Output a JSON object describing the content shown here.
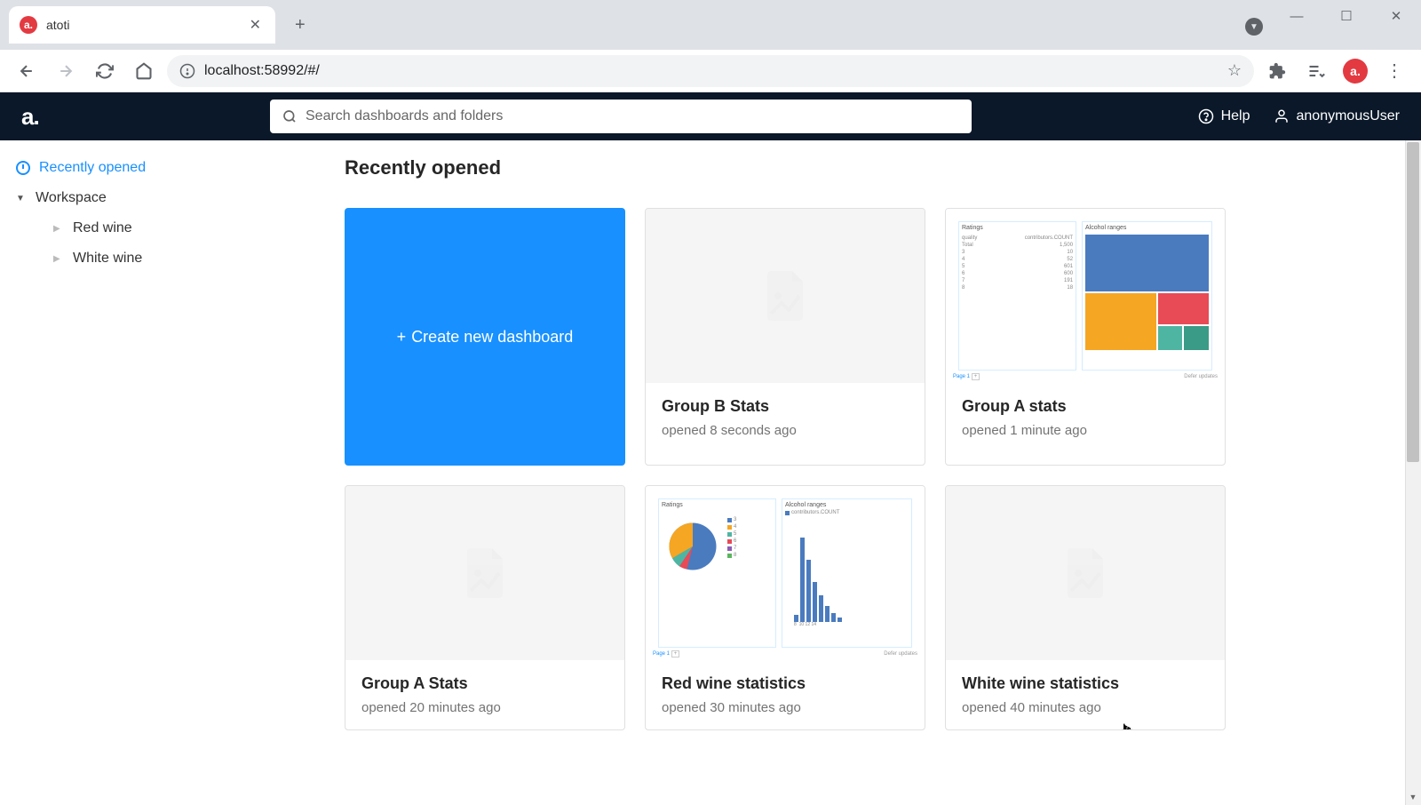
{
  "browser": {
    "tab_title": "atoti",
    "url": "localhost:58992/#/"
  },
  "header": {
    "logo": "a.",
    "search_placeholder": "Search dashboards and folders",
    "help_label": "Help",
    "user_label": "anonymousUser"
  },
  "sidebar": {
    "recently_opened": "Recently opened",
    "workspace": "Workspace",
    "items": [
      {
        "label": "Red wine"
      },
      {
        "label": "White wine"
      }
    ]
  },
  "content": {
    "heading": "Recently opened",
    "create_label": "Create new dashboard",
    "cards": [
      {
        "title": "Group B Stats",
        "meta": "opened 8 seconds ago",
        "thumb": "placeholder"
      },
      {
        "title": "Group A stats",
        "meta": "opened 1 minute ago",
        "thumb": "treemap"
      },
      {
        "title": "Group A Stats",
        "meta": "opened 20 minutes ago",
        "thumb": "placeholder"
      },
      {
        "title": "Red wine statistics",
        "meta": "opened 30 minutes ago",
        "thumb": "piehist"
      },
      {
        "title": "White wine statistics",
        "meta": "opened 40 minutes ago",
        "thumb": "placeholder"
      }
    ]
  },
  "thumb_details": {
    "ratings_label": "Ratings",
    "alcohol_label": "Alcohol ranges",
    "page_label": "Page 1",
    "updates_label": "Defer updates",
    "contributors_label": "contributors.COUNT"
  }
}
